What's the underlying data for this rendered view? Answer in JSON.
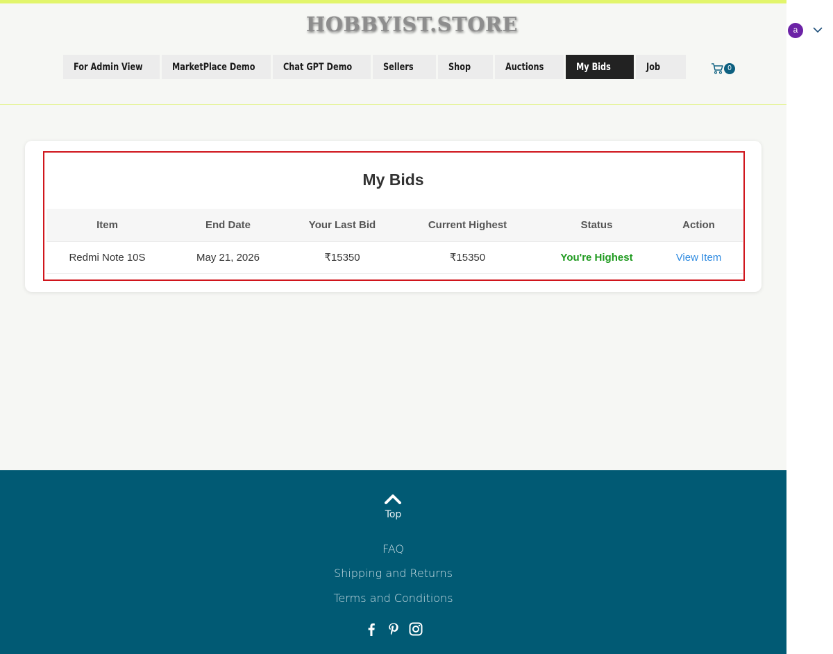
{
  "site": {
    "logo": "HOBBYIST.STORE",
    "colors": {
      "accent_strip": "#e2f56b",
      "footer_bg": "#015a74",
      "status_green": "#1f9a1f",
      "link_blue": "#2d8ae0",
      "highlight_red": "#d0151c"
    }
  },
  "nav": {
    "items": [
      {
        "label": "For Admin View",
        "active": false
      },
      {
        "label": "MarketPlace Demo",
        "active": false
      },
      {
        "label": "Chat GPT Demo",
        "active": false
      },
      {
        "label": "Sellers",
        "active": false
      },
      {
        "label": "Shop",
        "active": false
      },
      {
        "label": "Auctions",
        "active": false
      },
      {
        "label": "My Bids",
        "active": true
      },
      {
        "label": "Job",
        "active": false
      }
    ],
    "cart_count": "0",
    "cart_icon": "shopping-cart-icon"
  },
  "user": {
    "avatar_letter": "a",
    "menu_icon": "chevron-down-icon"
  },
  "bids": {
    "title": "My Bids",
    "columns": [
      "Item",
      "End Date",
      "Your Last Bid",
      "Current Highest",
      "Status",
      "Action"
    ],
    "rows": [
      {
        "item": "Redmi Note 10S",
        "end_date": "May 21, 2026",
        "your_last_bid": "₹15350",
        "current_highest": "₹15350",
        "status": "You're Highest",
        "action": "View Item"
      }
    ]
  },
  "footer": {
    "top_label": "Top",
    "links": [
      "FAQ",
      "Shipping and Returns",
      "Terms and Conditions"
    ],
    "social": [
      "facebook-icon",
      "pinterest-icon",
      "instagram-icon"
    ]
  }
}
